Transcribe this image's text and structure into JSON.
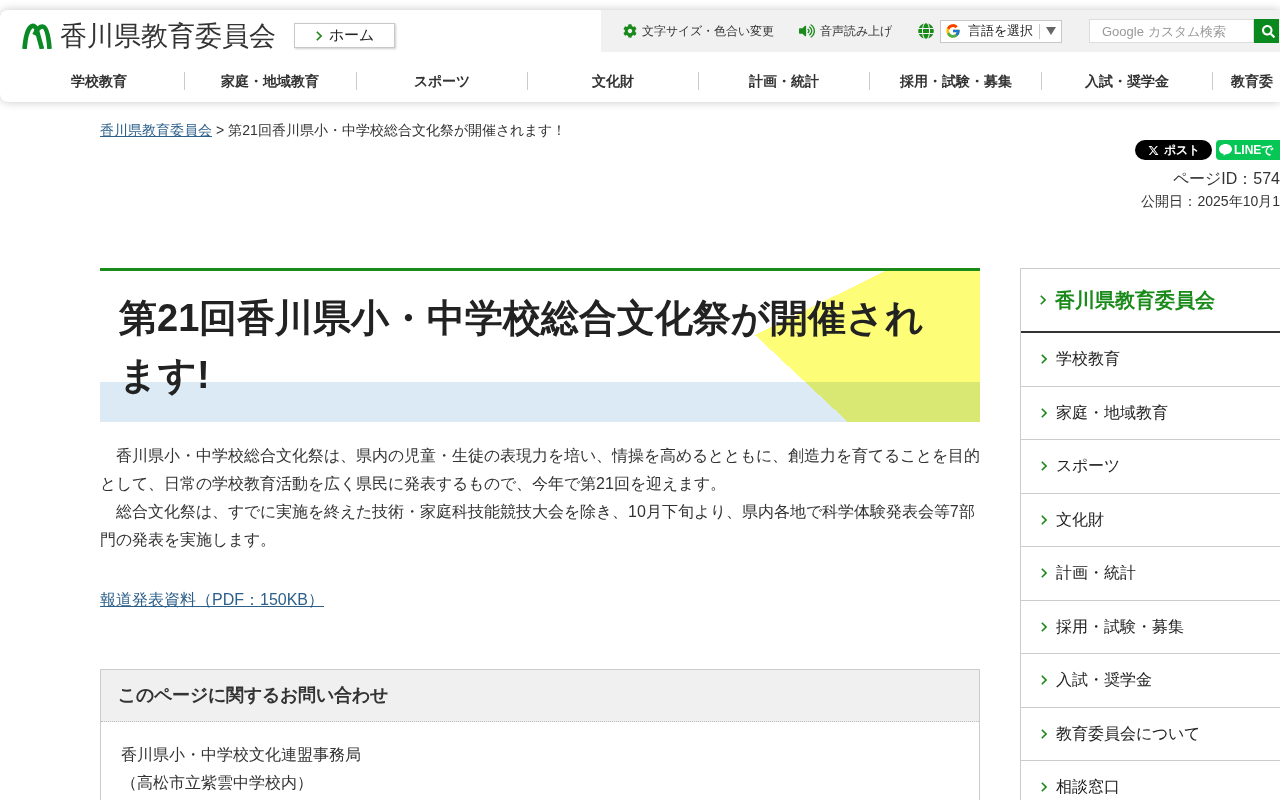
{
  "header": {
    "site_title": "香川県教育委員会",
    "home_button": "ホーム",
    "utility_links": [
      {
        "kind": "text_size",
        "label": "文字サイズ・色合い変更"
      },
      {
        "kind": "speech",
        "label": "音声読み上げ"
      }
    ],
    "language_select": {
      "label": "言語を選択"
    },
    "search": {
      "placeholder": "Google カスタム検索"
    }
  },
  "nav": [
    {
      "label": "学校教育"
    },
    {
      "label": "家庭・地域教育"
    },
    {
      "label": "スポーツ"
    },
    {
      "label": "文化財"
    },
    {
      "label": "計画・統計"
    },
    {
      "label": "採用・試験・募集"
    },
    {
      "label": "入試・奨学金"
    },
    {
      "label": "教育委"
    }
  ],
  "breadcrumb": {
    "items": [
      {
        "kind": "link",
        "label": "香川県教育委員会"
      },
      {
        "kind": "current",
        "label": "第21回香川県小・中学校総合文化祭が開催されます！"
      }
    ],
    "separator": ">"
  },
  "share_buttons": [
    {
      "kind": "x",
      "label": "ポスト"
    },
    {
      "kind": "line",
      "label": "LINEで"
    }
  ],
  "page_id": "ページID：574",
  "published": "公開日：2025年10月1",
  "article": {
    "title": "第21回香川県小・中学校総合文化祭が開催されます!",
    "paragraphs": [
      "　香川県小・中学校総合文化祭は、県内の児童・生徒の表現力を培い、情操を高めるとともに、創造力を育てることを目的として、日常の学校教育活動を広く県民に発表するもので、今年で第21回を迎えます。",
      "　総合文化祭は、すでに実施を終えた技術・家庭科技能競技大会を除き、10月下旬より、県内各地で科学体験発表会等7部門の発表を実施します。"
    ],
    "attachment_link": "報道発表資料（PDF：150KB）"
  },
  "contact": {
    "heading": "このページに関するお問い合わせ",
    "lines": [
      "香川県小・中学校文化連盟事務局",
      "（高松市立紫雲中学校内）"
    ]
  },
  "sidebar": {
    "heading": "香川県教育委員会",
    "items": [
      "学校教育",
      "家庭・地域教育",
      "スポーツ",
      "文化財",
      "計画・統計",
      "採用・試験・募集",
      "入試・奨学金",
      "教育委員会について",
      "相談窓口"
    ]
  }
}
